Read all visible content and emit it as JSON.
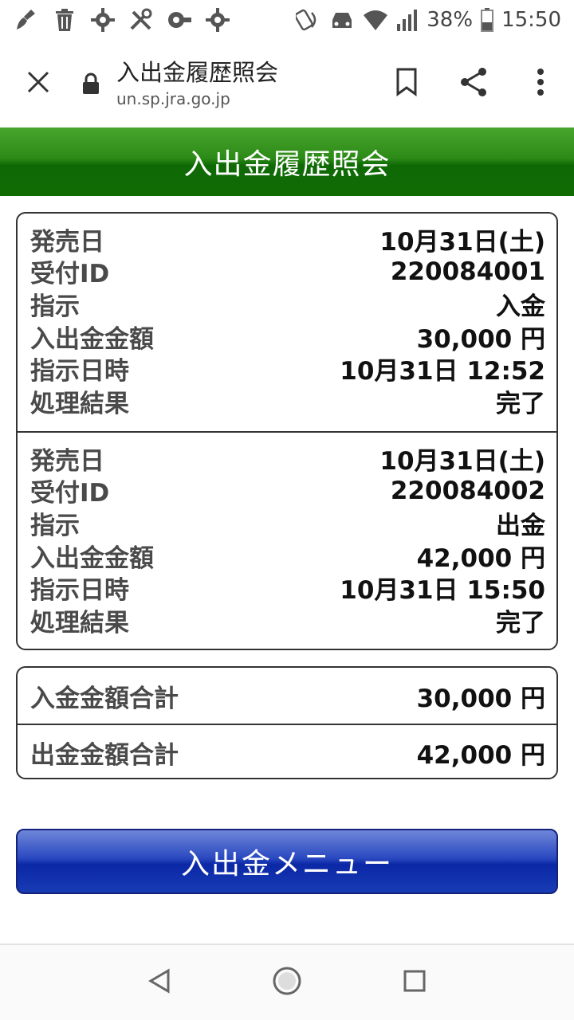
{
  "statusbar": {
    "battery": "38%",
    "time": "15:50",
    "icons": [
      "broom-icon",
      "trash-icon",
      "gear-icon",
      "tools-icon",
      "vpn-key-icon",
      "gear-icon"
    ]
  },
  "browser": {
    "title": "入出金履歴照会",
    "url": "un.sp.jra.go.jp"
  },
  "page": {
    "header": "入出金履歴照会"
  },
  "records": [
    {
      "rows": [
        {
          "label": "発売日",
          "value": "10月31日(土)"
        },
        {
          "label": "受付ID",
          "value": "220084001"
        },
        {
          "label": "指示",
          "value": "入金"
        },
        {
          "label": "入出金金額",
          "value": "30,000 円"
        },
        {
          "label": "指示日時",
          "value": "10月31日 12:52"
        },
        {
          "label": "処理結果",
          "value": "完了"
        }
      ]
    },
    {
      "rows": [
        {
          "label": "発売日",
          "value": "10月31日(土)"
        },
        {
          "label": "受付ID",
          "value": "220084002"
        },
        {
          "label": "指示",
          "value": "出金"
        },
        {
          "label": "入出金金額",
          "value": "42,000 円"
        },
        {
          "label": "指示日時",
          "value": "10月31日 15:50"
        },
        {
          "label": "処理結果",
          "value": "完了"
        }
      ]
    }
  ],
  "totals": {
    "deposit_label": "入金金額合計",
    "deposit_value": "30,000 円",
    "withdraw_label": "出金金額合計",
    "withdraw_value": "42,000 円"
  },
  "menu_button": "入出金メニュー",
  "colors": {
    "header_green": "#2c8a17",
    "button_blue": "#0b27a5"
  }
}
